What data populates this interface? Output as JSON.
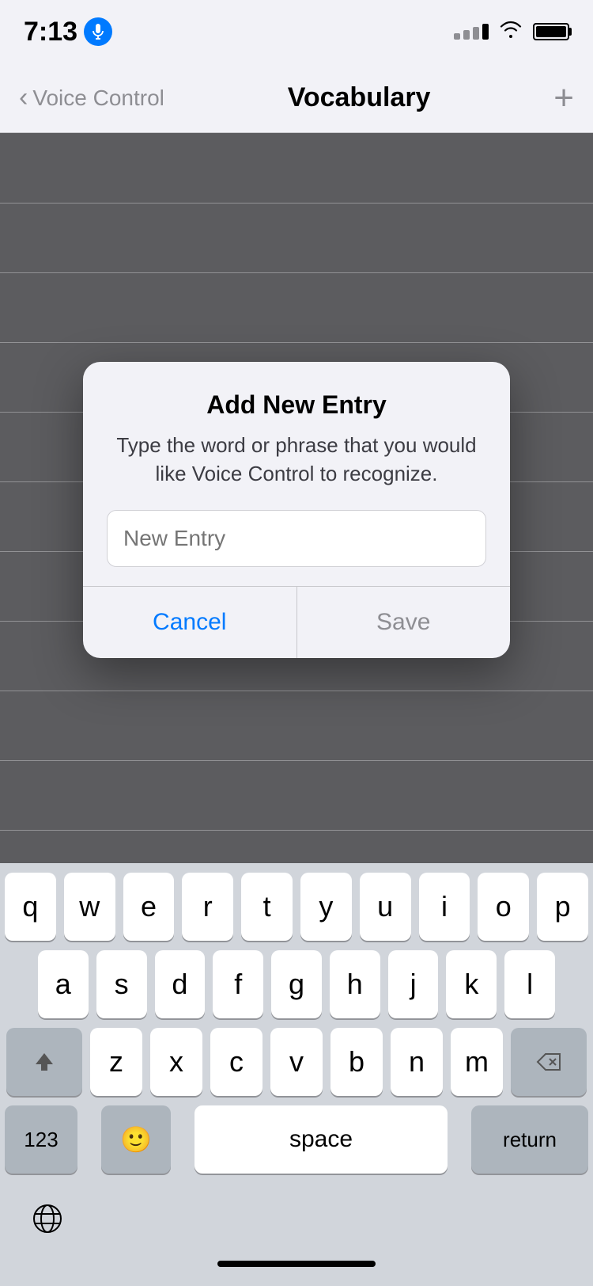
{
  "statusBar": {
    "time": "7:13",
    "micActive": true
  },
  "navBar": {
    "backLabel": "Voice Control",
    "title": "Vocabulary",
    "addLabel": "+"
  },
  "modal": {
    "title": "Add New Entry",
    "message": "Type the word or phrase that you would like Voice Control to recognize.",
    "inputPlaceholder": "New Entry",
    "cancelLabel": "Cancel",
    "saveLabel": "Save"
  },
  "keyboard": {
    "row1": [
      "q",
      "w",
      "e",
      "r",
      "t",
      "y",
      "u",
      "i",
      "o",
      "p"
    ],
    "row2": [
      "a",
      "s",
      "d",
      "f",
      "g",
      "h",
      "j",
      "k",
      "l"
    ],
    "row3": [
      "z",
      "x",
      "c",
      "v",
      "b",
      "n",
      "m"
    ],
    "spaceLabel": "space",
    "returnLabel": "return",
    "numbersLabel": "123",
    "emojiLabel": "🙂"
  },
  "colors": {
    "blue": "#007aff",
    "gray": "#8e8e93",
    "white": "#ffffff",
    "keyBackground": "#ffffff",
    "specialKeyBackground": "#adb5bd"
  }
}
